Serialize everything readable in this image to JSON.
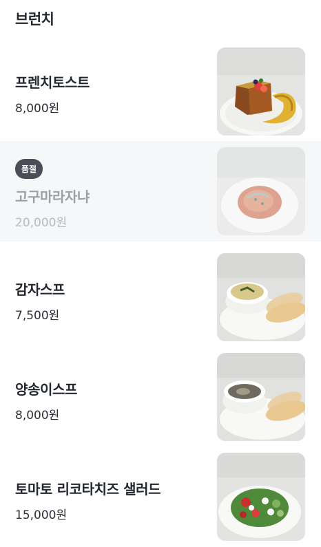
{
  "section": {
    "title": "브런치"
  },
  "items": [
    {
      "name": "프렌치토스트",
      "price": "8,000원",
      "image_icon": "french-toast-photo",
      "sold_out": false
    },
    {
      "name": "고구마라자냐",
      "price": "20,000원",
      "image_icon": "lasagna-photo",
      "sold_out": true,
      "badge": "품절"
    },
    {
      "name": "감자스프",
      "price": "7,500원",
      "image_icon": "potato-soup-photo",
      "sold_out": false
    },
    {
      "name": "양송이스프",
      "price": "8,000원",
      "image_icon": "mushroom-soup-photo",
      "sold_out": false
    },
    {
      "name": "토마토 리코타치즈 샐러드",
      "price": "15,000원",
      "image_icon": "salad-photo",
      "sold_out": false
    }
  ],
  "colors": {
    "soldout_bg": "#f6f7f9",
    "badge_bg": "#4a4f57",
    "text_primary": "#23272e",
    "text_disabled": "#9aa0a8"
  }
}
